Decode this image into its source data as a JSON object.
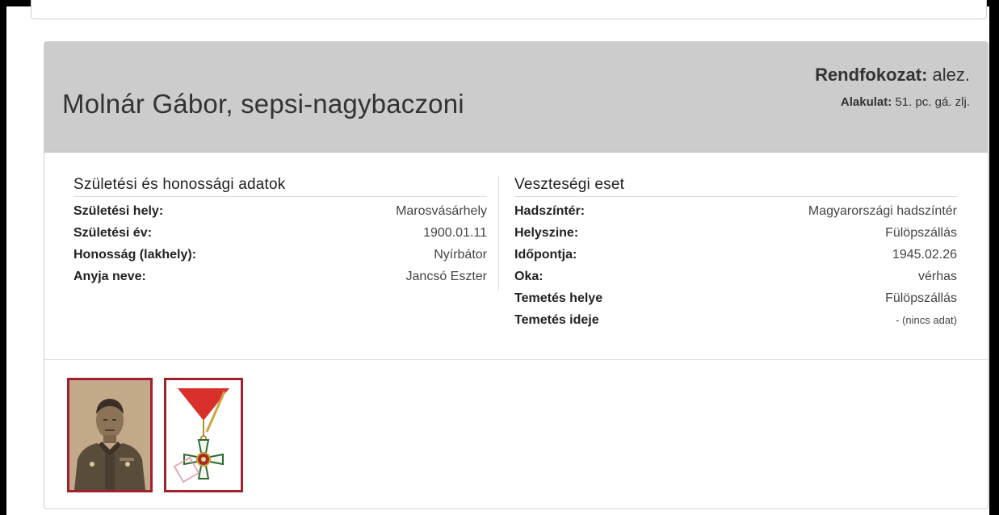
{
  "header": {
    "name": "Molnár Gábor, sepsi-nagybaczoni",
    "rank_label": "Rendfokozat:",
    "rank_value": "alez.",
    "unit_label": "Alakulat:",
    "unit_value": "51. pc. gá. zlj."
  },
  "birth": {
    "title": "Születési és honossági adatok",
    "rows": [
      {
        "label": "Születési hely:",
        "value": "Marosvásárhely"
      },
      {
        "label": "Születési év:",
        "value": "1900.01.11"
      },
      {
        "label": "Honosság (lakhely):",
        "value": "Nyírbátor"
      },
      {
        "label": "Anyja neve:",
        "value": "Jancsó Eszter"
      }
    ]
  },
  "loss": {
    "title": "Veszteségi eset",
    "rows": [
      {
        "label": "Hadszíntér:",
        "value": "Magyarországi hadszíntér"
      },
      {
        "label": "Helyszine:",
        "value": "Fülöpszállás"
      },
      {
        "label": "Időpontja:",
        "value": "1945.02.26"
      },
      {
        "label": "Oka:",
        "value": "vérhas"
      },
      {
        "label": "Temetés helye",
        "value": "Fülöpszállás"
      },
      {
        "label": "Temetés ideje",
        "value": "- (nincs adat)"
      }
    ]
  },
  "colors": {
    "header_bg": "#cccccc",
    "thumb_border": "#a3212c"
  }
}
